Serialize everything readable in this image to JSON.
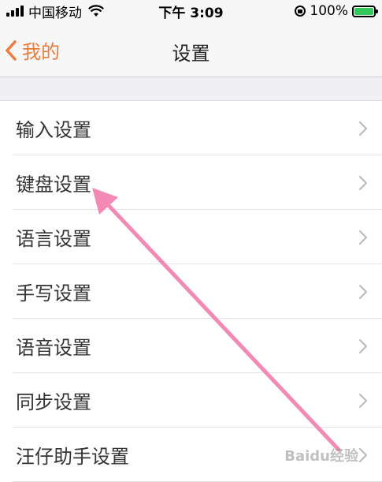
{
  "status_bar": {
    "carrier": "中国移动",
    "time": "下午 3:09",
    "battery": "100%"
  },
  "nav": {
    "back_label": "我的",
    "title": "设置"
  },
  "settings": [
    {
      "label": "输入设置"
    },
    {
      "label": "键盘设置"
    },
    {
      "label": "语言设置"
    },
    {
      "label": "手写设置"
    },
    {
      "label": "语音设置"
    },
    {
      "label": "同步设置"
    },
    {
      "label": "汪仔助手设置"
    }
  ],
  "watermark": "Baidu经验",
  "colors": {
    "accent": "#ee7b3b",
    "annotation_arrow": "#f28ab5",
    "battery_fill": "#34c759"
  }
}
